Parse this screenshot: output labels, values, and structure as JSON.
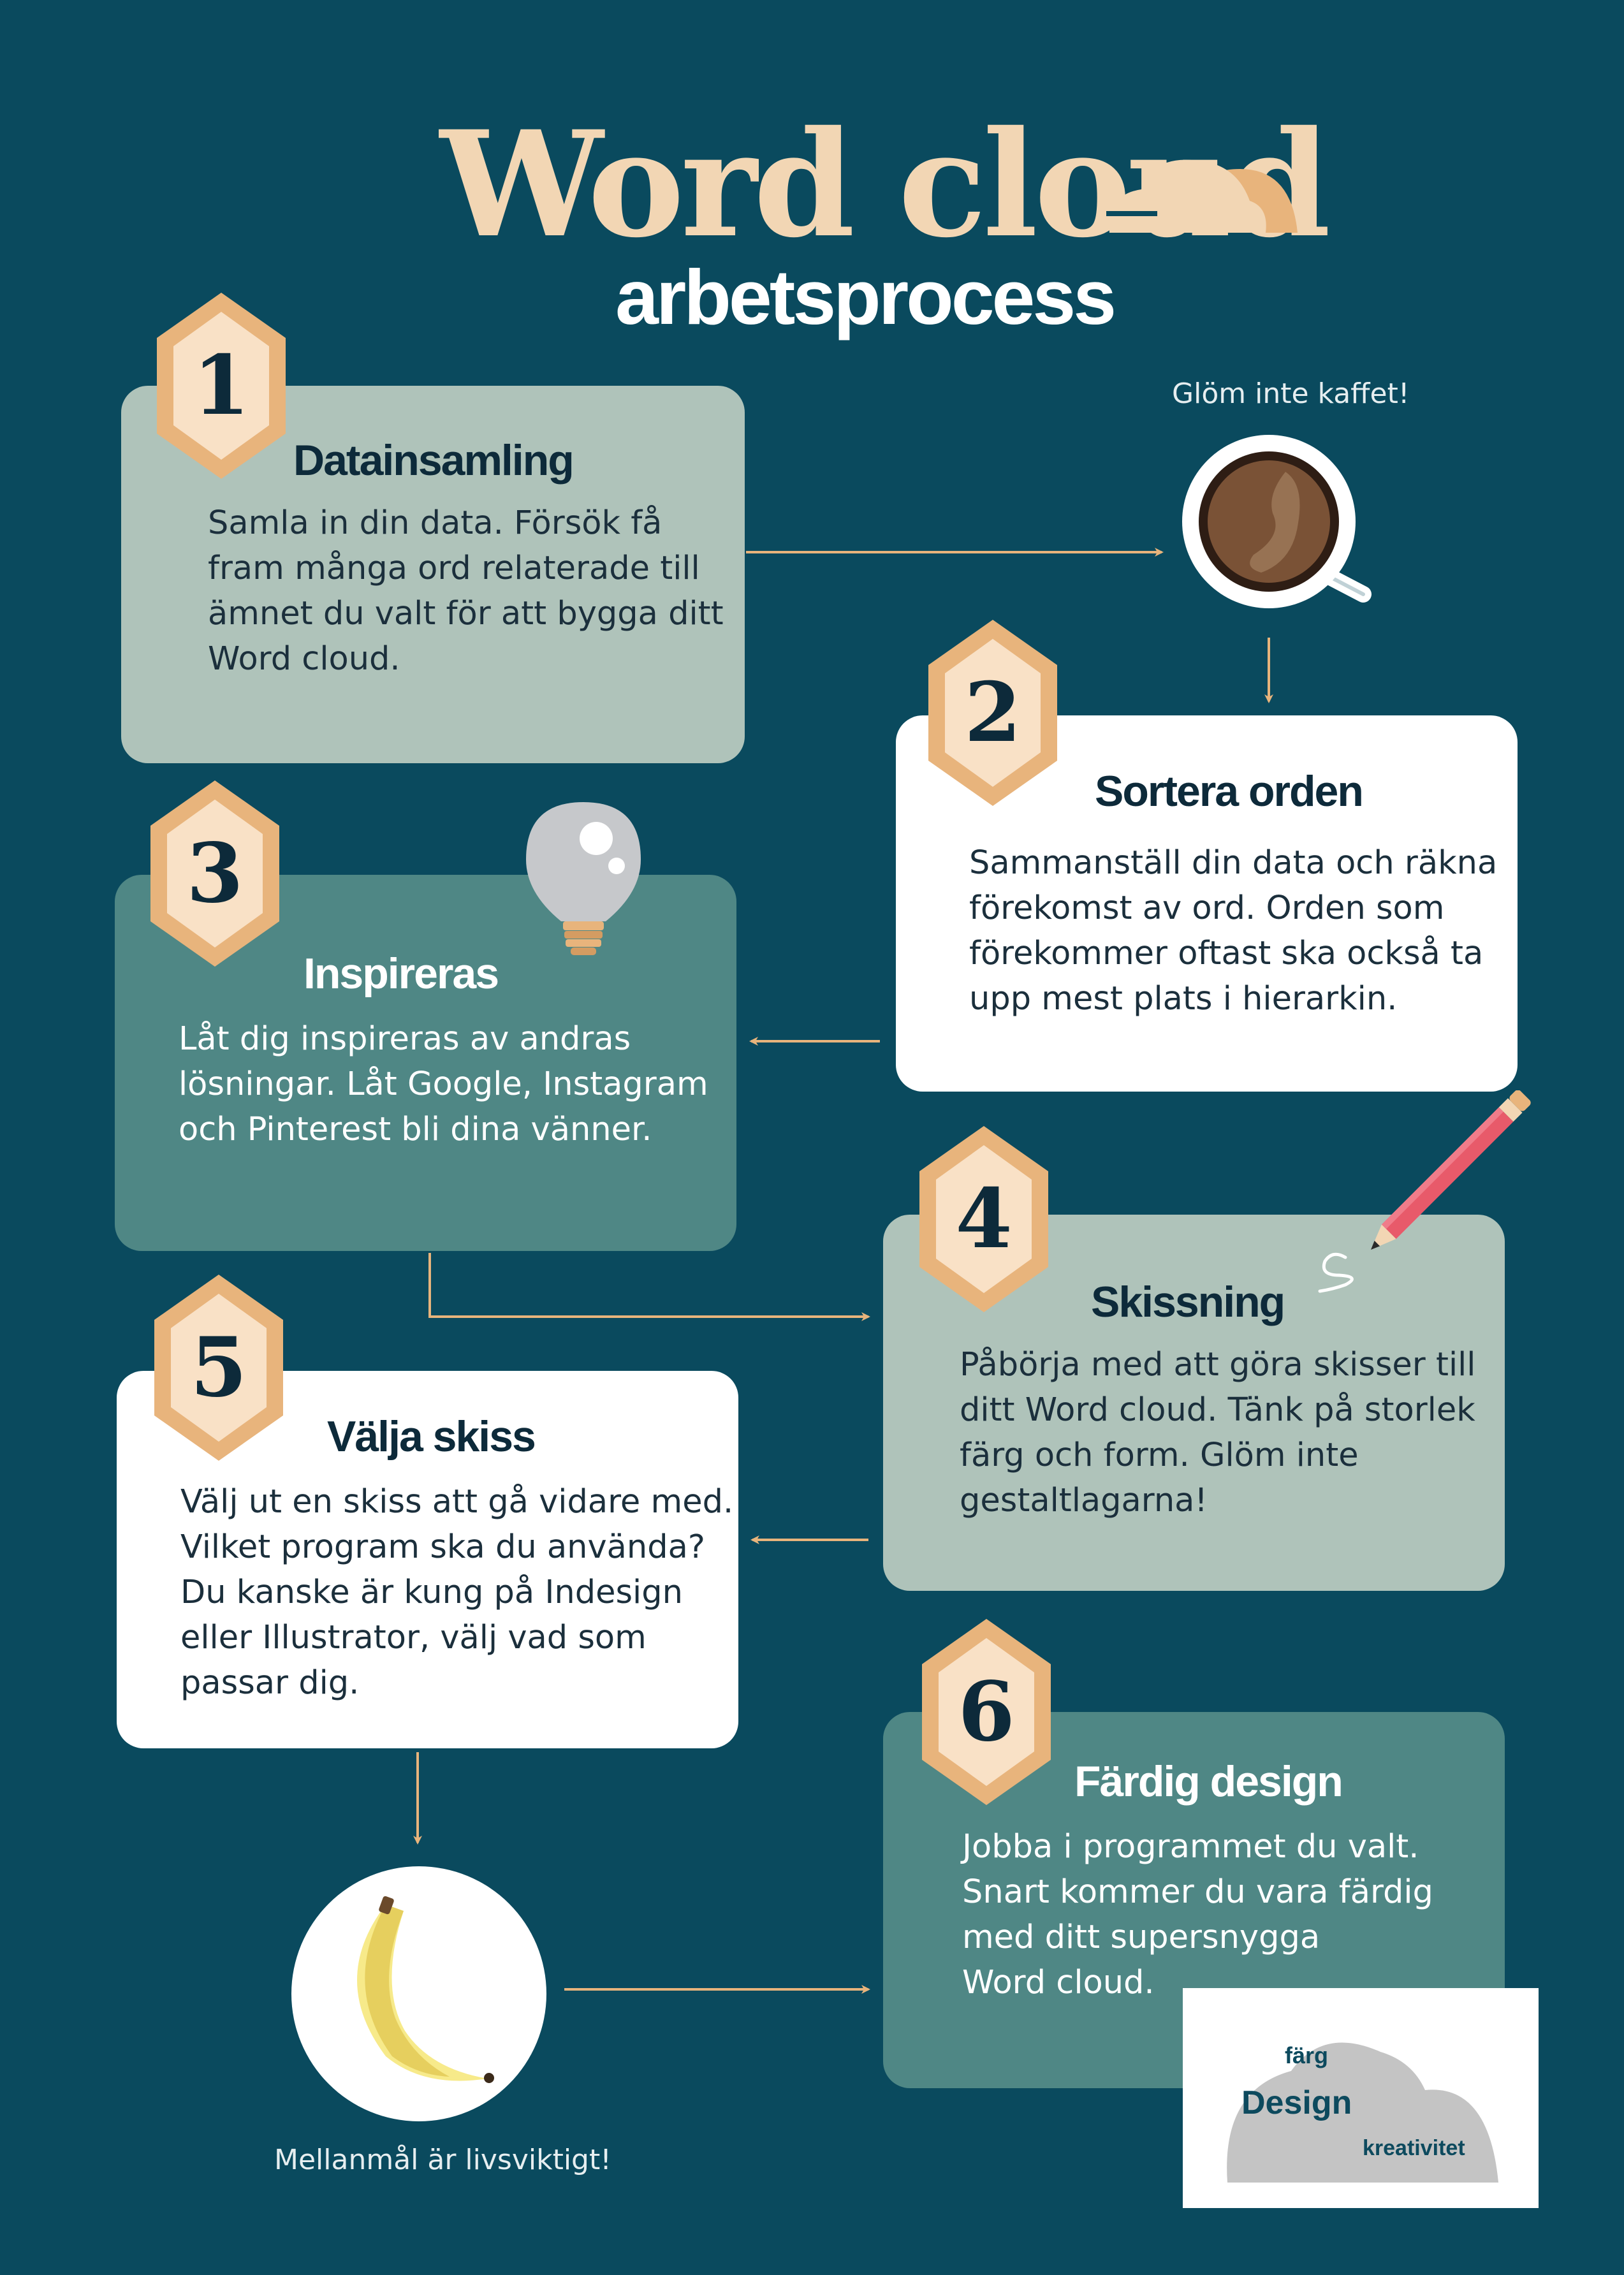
{
  "header": {
    "title": "Word cloud",
    "subtitle": "arbetsprocess"
  },
  "steps": [
    {
      "number": "1",
      "title": "Datainsamling",
      "text": "Samla in din data. Försök få\nfram många ord relaterade till\nämnet du valt för att bygga ditt\nWord cloud."
    },
    {
      "number": "2",
      "title": "Sortera orden",
      "text": "Sammanställ din data och räkna\nförekomst av ord. Orden som\nförekommer oftast ska också ta\nupp mest plats i hierarkin."
    },
    {
      "number": "3",
      "title": "Inspireras",
      "text": "Låt dig inspireras av andras\nlösningar. Låt Google, Instagram\noch Pinterest bli dina vänner."
    },
    {
      "number": "4",
      "title": "Skissning",
      "text": "Påbörja med att göra skisser till\nditt Word cloud. Tänk på storlek\nfärg och form. Glöm inte\ngestaltlagarna!"
    },
    {
      "number": "5",
      "title": "Välja skiss",
      "text": "Välj ut en skiss att gå vidare med.\nVilket program ska du använda?\nDu kanske är kung på Indesign\neller Illustrator, välj vad som\npassar dig."
    },
    {
      "number": "6",
      "title": "Färdig design",
      "text": "Jobba i programmet du valt.\nSnart kommer du vara färdig\nmed ditt supersnygga\nWord cloud."
    }
  ],
  "captions": {
    "coffee": "Glöm inte kaffet!",
    "snack": "Mellanmål är livsviktigt!"
  },
  "logo": {
    "word_top": "färg",
    "word_main": "Design",
    "word_bottom": "kreativitet"
  },
  "colors": {
    "background": "#0a4a5e",
    "card_sage": "#afc3ba",
    "card_teal": "#4f8785",
    "card_white": "#ffffff",
    "accent_peach": "#e8b47c",
    "title_cream": "#f2d6b4"
  },
  "icons": [
    "cloud-icon",
    "coffee-cup-icon",
    "lightbulb-icon",
    "pencil-icon",
    "banana-icon"
  ]
}
